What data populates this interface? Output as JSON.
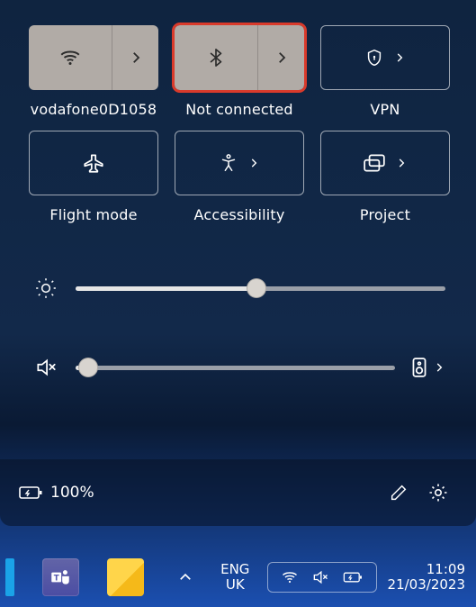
{
  "tiles": {
    "wifi": {
      "label": "vodafone0D1058"
    },
    "bluetooth": {
      "label": "Not connected"
    },
    "vpn": {
      "label": "VPN"
    },
    "flight": {
      "label": "Flight mode"
    },
    "accessibility": {
      "label": "Accessibility"
    },
    "project": {
      "label": "Project"
    }
  },
  "sliders": {
    "brightness": {
      "value": 49
    },
    "volume": {
      "value": 4
    }
  },
  "battery": {
    "text": "100%"
  },
  "taskbar": {
    "lang_top": "ENG",
    "lang_bottom": "UK",
    "time": "11:09",
    "date": "21/03/2023"
  }
}
